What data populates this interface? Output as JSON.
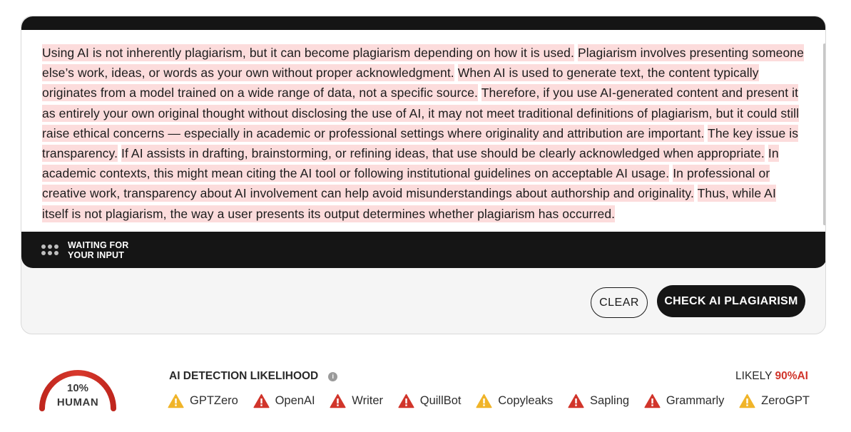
{
  "editor": {
    "sentences": [
      "Using AI is not inherently plagiarism, but it can become plagiarism depending on how it is used.",
      "Plagiarism involves presenting someone else’s work, ideas, or words as your own without proper acknowledgment.",
      "When AI is used to generate text, the content typically originates from a model trained on a wide range of data, not a specific source.",
      "Therefore, if you use AI-generated content and present it as entirely your own original thought without disclosing the use of AI, it may not meet traditional definitions of plagiarism, but it could still raise ethical concerns — especially in academic or professional settings where originality and attribution are important.",
      "The key issue is transparency.",
      "If AI assists in drafting, brainstorming, or refining ideas, that use should be clearly acknowledged when appropriate.",
      "In academic contexts, this might mean citing the AI tool or following institutional guidelines on acceptable AI usage.",
      "In professional or creative work, transparency about AI involvement can help avoid misunderstandings about authorship and originality.",
      "Thus, while AI itself is not plagiarism, the way a user presents its output determines whether plagiarism has occurred."
    ],
    "status_label": "WAITING FOR\nYOUR INPUT"
  },
  "actions": {
    "clear_label": "CLEAR",
    "check_label": "CHECK AI PLAGIARISM"
  },
  "result": {
    "human_percent": "10%",
    "human_label": "HUMAN",
    "human_fraction": 0.1,
    "detection_title": "AI DETECTION LIKELIHOOD",
    "likely_prefix": "LIKELY",
    "likely_value": "90%AI",
    "detectors": [
      {
        "name": "GPTZero",
        "level": "warning",
        "color": "#f0b429"
      },
      {
        "name": "OpenAI",
        "level": "alert",
        "color": "#d1352b"
      },
      {
        "name": "Writer",
        "level": "alert",
        "color": "#d1352b"
      },
      {
        "name": "QuillBot",
        "level": "alert",
        "color": "#d1352b"
      },
      {
        "name": "Copyleaks",
        "level": "warning",
        "color": "#f0b429"
      },
      {
        "name": "Sapling",
        "level": "alert",
        "color": "#d1352b"
      },
      {
        "name": "Grammarly",
        "level": "alert",
        "color": "#d1352b"
      },
      {
        "name": "ZeroGPT",
        "level": "warning",
        "color": "#f0b429"
      }
    ]
  },
  "colors": {
    "highlight": "#fcdcdc",
    "ai_red": "#d1352b",
    "dark": "#151515"
  }
}
